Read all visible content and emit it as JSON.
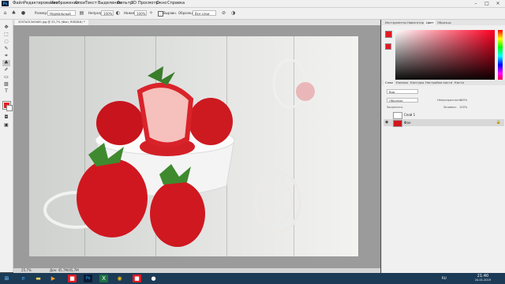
{
  "menubar": {
    "items": [
      "Файл",
      "Редактирование",
      "Изображение",
      "Слои",
      "Текст",
      "Выделение",
      "Фильтр",
      "3D",
      "Просмотр",
      "Окно",
      "Справка"
    ]
  },
  "options": {
    "size_label": "Размер:",
    "size_value": "Нормальный",
    "opacity_label": "Непрозр.:",
    "opacity_value": "100%",
    "flow_label": "Нажим:",
    "flow_value": "100%",
    "align_label": "Выравн.",
    "sample_label": "Образец:",
    "sample_value": "Все слои"
  },
  "document": {
    "tab_title": "2097a513e0d00.jpg @ 25,7% (Фон, RGB/8#) *",
    "zoom": "25,7%",
    "doc_size": "Док: 45,7М/45,7М"
  },
  "panels": {
    "top_tabs": [
      "Инструменты",
      "Навигатор",
      "Цвет",
      "Образцы"
    ],
    "active_top_tab": "Цвет",
    "layer_tabs": [
      "Слои",
      "Каналы",
      "Контуры",
      "Настройки кисти",
      "Кисти"
    ],
    "active_layer_tab": "Слои",
    "layer_filter": "Вид",
    "blend_mode": "Обычные",
    "opacity_label": "Непрозрачность:",
    "opacity_value": "100%",
    "lock_label": "Закрепить:",
    "fill_label": "Заливка:",
    "fill_value": "100%",
    "layers": [
      {
        "name": "Слой 1",
        "visible": false
      },
      {
        "name": "Фон",
        "visible": true,
        "selected": true
      }
    ]
  },
  "colors": {
    "foreground": "#e31b23",
    "background": "#ffffff",
    "taskbar": "#1c3b56"
  },
  "taskbar": {
    "time": "21:40",
    "date": "24.01.2019",
    "language": "RU"
  },
  "icons": [
    "start-icon",
    "ie-icon",
    "explorer-icon",
    "media-icon",
    "photoshop-icon",
    "excel-icon",
    "chrome-icon",
    "paint-icon",
    "obs-icon"
  ]
}
